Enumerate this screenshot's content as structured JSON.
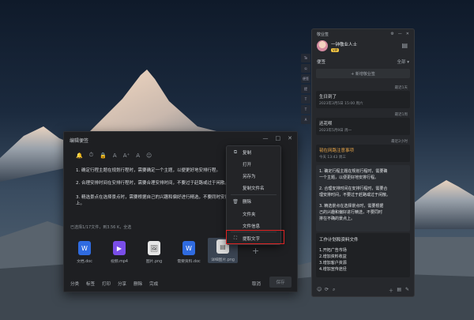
{
  "editor": {
    "title": "编辑便签",
    "win_min": "—",
    "win_max": "□",
    "win_close": "✕",
    "toolbar_icons": [
      "bell-icon",
      "clock-icon",
      "lock-icon",
      "font-icon",
      "font-size-up-icon",
      "font-color-icon",
      "emoji-icon"
    ],
    "toolbar_glyphs": [
      "🔔",
      "⏱",
      "🔒",
      "A",
      "A⁺",
      "A",
      "☺"
    ],
    "lines": [
      "1. 确定行程主题在规划行程时，需要确定一个主题，以便更好地安排行程。",
      "2. 合理安排时间在安排行程时，需要合理安排时间，不要过于赶路或过于闲散。",
      "3. 精选景点在选择景点时，需要根据自己的兴趣和偏好进行精选，不要同时安排过",
      "上。"
    ],
    "status": "已选择1/17文件，到3.56 K，全选",
    "attachments": [
      {
        "label": "文档.doc",
        "icon": "W",
        "color": "#2f6be0"
      },
      {
        "label": "视频.mp4",
        "icon": "▶",
        "color": "#7a4ee8"
      },
      {
        "label": "图片.png",
        "icon": "🖼",
        "color": "#e6e6e6"
      },
      {
        "label": "需要资料.doc",
        "icon": "W",
        "color": "#2f6be0"
      },
      {
        "label": "详细图片.png",
        "icon": "▤",
        "color": "#d9d9d9"
      }
    ],
    "add": "+",
    "bottom_actions": [
      "分类",
      "标签",
      "打印",
      "分享",
      "删除",
      "完成"
    ],
    "cancel": "取消",
    "save": "保存"
  },
  "context_menu": {
    "items": [
      {
        "label": "复制",
        "icon": "copy-icon",
        "glyph": "⧉"
      },
      {
        "label": "打开",
        "icon": "",
        "glyph": ""
      },
      {
        "label": "另存为",
        "icon": "",
        "glyph": ""
      },
      {
        "label": "复制文件名",
        "icon": "",
        "glyph": ""
      },
      {
        "label": "删除",
        "icon": "trash-icon",
        "glyph": "🗑"
      },
      {
        "label": "文件夹",
        "icon": "",
        "glyph": ""
      },
      {
        "label": "文件信息",
        "icon": "",
        "glyph": ""
      },
      {
        "label": "提取文字",
        "icon": "scan-text-icon",
        "glyph": "⛶"
      }
    ],
    "highlight_color": "#e02424"
  },
  "panel": {
    "app_name": "敬业签",
    "top_btns": [
      "⚙",
      "—",
      "✕"
    ],
    "username": "一钟敬业人士",
    "vip": "VIP",
    "section": "便签",
    "filter": "全部 ▾",
    "new_note": "+ 新增敬业签",
    "notes": [
      {
        "time": "最近1天",
        "title": "生日到了",
        "date": "2023年3月5日 15:00 周六"
      },
      {
        "time": "最近1周",
        "title": "还花呗",
        "date": "2023年5月9日 周一"
      },
      {
        "time": "最近2小时",
        "title": "韧在网路注意事项",
        "date": "今天 13:43 周三"
      }
    ],
    "big_note_lines": [
      "1. 确定行程主题在规划行程时，需要确",
      "一个主题，以便更好地安排行程。",
      "",
      "2. 合理安排时间在安排行程时，需要合",
      "理安排时间，不要过于赶路或过于闲散。",
      "",
      "3. 精选景点在选择景点时，需要根据",
      "己的兴趣和偏好进行精选，不要同时",
      "排在不确的景点上。"
    ],
    "list_note_title": "工作计划和资料文件",
    "list_note_lines": [
      "1.开拓广告市场",
      "2.增加资料收益",
      "3.增加客户资源",
      "4.增加宣传途径"
    ],
    "bottom_icons": [
      "☺",
      "⟳",
      "⌕",
      "＋",
      "▤",
      "✎"
    ]
  },
  "side_strip": [
    "Te",
    "公",
    "便签",
    "提",
    "T",
    "T",
    "A"
  ]
}
